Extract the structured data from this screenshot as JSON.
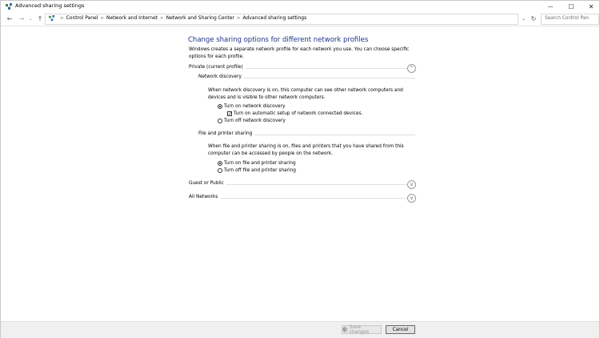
{
  "window": {
    "title": "Advanced sharing settings",
    "controls": {
      "minimize": "—",
      "maximize": "☐",
      "close": "✕"
    }
  },
  "nav": {
    "back": "←",
    "forward": "→",
    "recent": "⌄",
    "up": "↑"
  },
  "address": {
    "breadcrumbs": [
      "Control Panel",
      "Network and Internet",
      "Network and Sharing Center",
      "Advanced sharing settings"
    ],
    "separator": ">",
    "dropdown": "⌄",
    "refresh": "↻"
  },
  "search": {
    "placeholder": "Search Control Pan"
  },
  "main": {
    "title": "Change sharing options for different network profiles",
    "description": "Windows creates a separate network profile for each network you use. You can choose specific options for each profile.",
    "profiles": [
      {
        "label": "Private (current profile)",
        "expanded": true,
        "chevron": "^",
        "groups": [
          {
            "label": "Network discovery",
            "description": "When network discovery is on, this computer can see other network computers and devices and is visible to other network computers.",
            "options": {
              "on": "Turn on network discovery",
              "auto_setup": "Turn on automatic setup of network connected devices.",
              "off": "Turn off network discovery"
            },
            "selected": "on",
            "auto_setup_checked": true
          },
          {
            "label": "File and printer sharing",
            "description": "When file and printer sharing is on, files and printers that you have shared from this computer can be accessed by people on the network.",
            "options": {
              "on": "Turn on file and printer sharing",
              "off": "Turn off file and printer sharing"
            },
            "selected": "on"
          }
        ]
      },
      {
        "label": "Guest or Public",
        "expanded": false,
        "chevron": "v"
      },
      {
        "label": "All Networks",
        "expanded": false,
        "chevron": "v"
      }
    ]
  },
  "footer": {
    "save_label": "Save changes",
    "cancel_label": "Cancel"
  },
  "colors": {
    "title_blue": "#1e3287",
    "footer_bg": "#f0f0f0",
    "divider": "#e0e0e0"
  }
}
